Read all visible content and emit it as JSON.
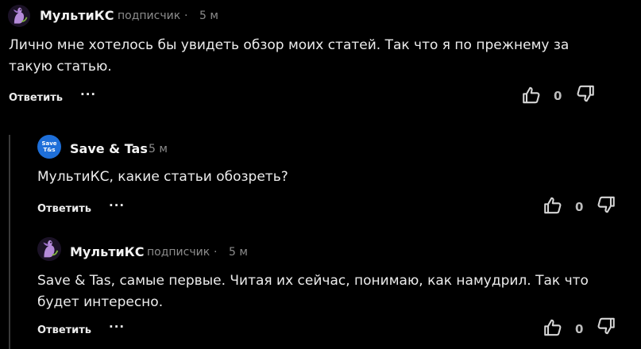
{
  "comments": [
    {
      "author": "МультиКС",
      "badge": "подписчик",
      "separator": "·",
      "time": "5 м",
      "text": "Лично мне хотелось бы увидеть обзор моих статей. Так что я по прежнему за такую статью.",
      "reply_label": "Ответить",
      "more_label": "···",
      "likes": "0",
      "avatar_icon": "purple-dragon-avatar-icon"
    },
    {
      "author": "Save & Tas",
      "time": "5 м",
      "text": "МультиКС, какие статьи обозреть?",
      "reply_label": "Ответить",
      "more_label": "···",
      "likes": "0",
      "avatar_text": "Save T&s",
      "avatar_icon": "blue-save-tas-avatar-icon"
    },
    {
      "author": "МультиКС",
      "badge": "подписчик",
      "separator": "·",
      "time": "5 м",
      "text": "Save & Tas, самые первые. Читая их сейчас, понимаю, как намудрил. Так что будет интересно.",
      "reply_label": "Ответить",
      "more_label": "···",
      "likes": "0",
      "avatar_icon": "purple-dragon-avatar-icon"
    }
  ],
  "colors": {
    "background": "#000000",
    "text": "#ececec",
    "muted": "#8c8c8c",
    "thread_line": "#3a3a3a",
    "avatar_blue": "#1e6fd9"
  }
}
